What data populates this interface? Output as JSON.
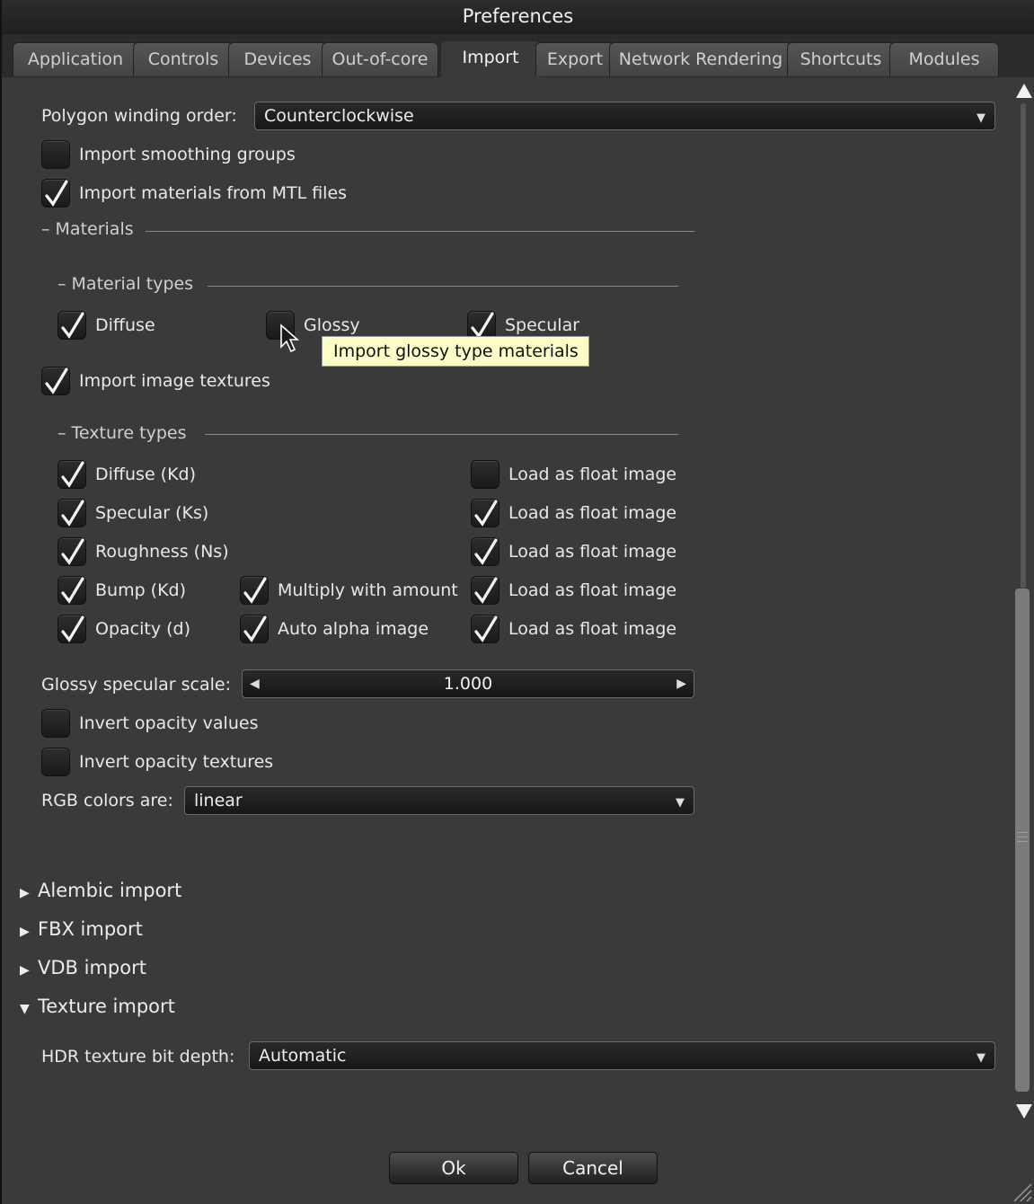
{
  "window": {
    "title": "Preferences"
  },
  "tabs": [
    {
      "label": "Application"
    },
    {
      "label": "Controls"
    },
    {
      "label": "Devices"
    },
    {
      "label": "Out-of-core"
    },
    {
      "label": "Import"
    },
    {
      "label": "Export"
    },
    {
      "label": "Network Rendering"
    },
    {
      "label": "Shortcuts"
    },
    {
      "label": "Modules"
    }
  ],
  "active_tab": "Import",
  "winding": {
    "label": "Polygon winding order:",
    "value": "Counterclockwise"
  },
  "options": {
    "smoothing": {
      "label": "Import smoothing groups",
      "checked": false
    },
    "mtl": {
      "label": "Import materials from MTL files",
      "checked": true
    }
  },
  "materials": {
    "heading": "– Materials",
    "types_heading": "– Material types",
    "diffuse": {
      "label": "Diffuse",
      "checked": true
    },
    "glossy": {
      "label": "Glossy",
      "checked": false
    },
    "specular": {
      "label": "Specular",
      "checked": true
    },
    "image_textures": {
      "label": "Import image textures",
      "checked": true
    },
    "texture_types_heading": "– Texture types",
    "texture_rows": [
      {
        "label": "Diffuse (Kd)",
        "checked": true,
        "extra": "",
        "float_label": "Load as float image",
        "float_checked": false
      },
      {
        "label": "Specular (Ks)",
        "checked": true,
        "extra": "",
        "float_label": "Load as float image",
        "float_checked": true
      },
      {
        "label": "Roughness (Ns)",
        "checked": true,
        "extra": "",
        "float_label": "Load as float image",
        "float_checked": true
      },
      {
        "label": "Bump (Kd)",
        "checked": true,
        "extra": "Multiply with amount",
        "extra_checked": true,
        "float_label": "Load as float image",
        "float_checked": true
      },
      {
        "label": "Opacity (d)",
        "checked": true,
        "extra": "Auto alpha image",
        "extra_checked": true,
        "float_label": "Load as float image",
        "float_checked": true
      }
    ]
  },
  "glossy_scale": {
    "label": "Glossy specular scale:",
    "value": "1.000"
  },
  "invert": {
    "values": {
      "label": "Invert opacity values",
      "checked": false
    },
    "textures": {
      "label": "Invert opacity textures",
      "checked": false
    }
  },
  "rgb": {
    "label": "RGB colors are:",
    "value": "linear"
  },
  "tree": [
    {
      "label": "Alembic import",
      "expanded": false
    },
    {
      "label": "FBX import",
      "expanded": false
    },
    {
      "label": "VDB import",
      "expanded": false
    },
    {
      "label": "Texture import",
      "expanded": true
    }
  ],
  "hdr": {
    "label": "HDR texture bit depth:",
    "value": "Automatic"
  },
  "tooltip": "Import glossy type materials",
  "buttons": {
    "ok": "Ok",
    "cancel": "Cancel"
  },
  "icons": {
    "check": "checkmark-icon",
    "expand": "triangle-right-icon",
    "collapse": "triangle-down-icon"
  }
}
